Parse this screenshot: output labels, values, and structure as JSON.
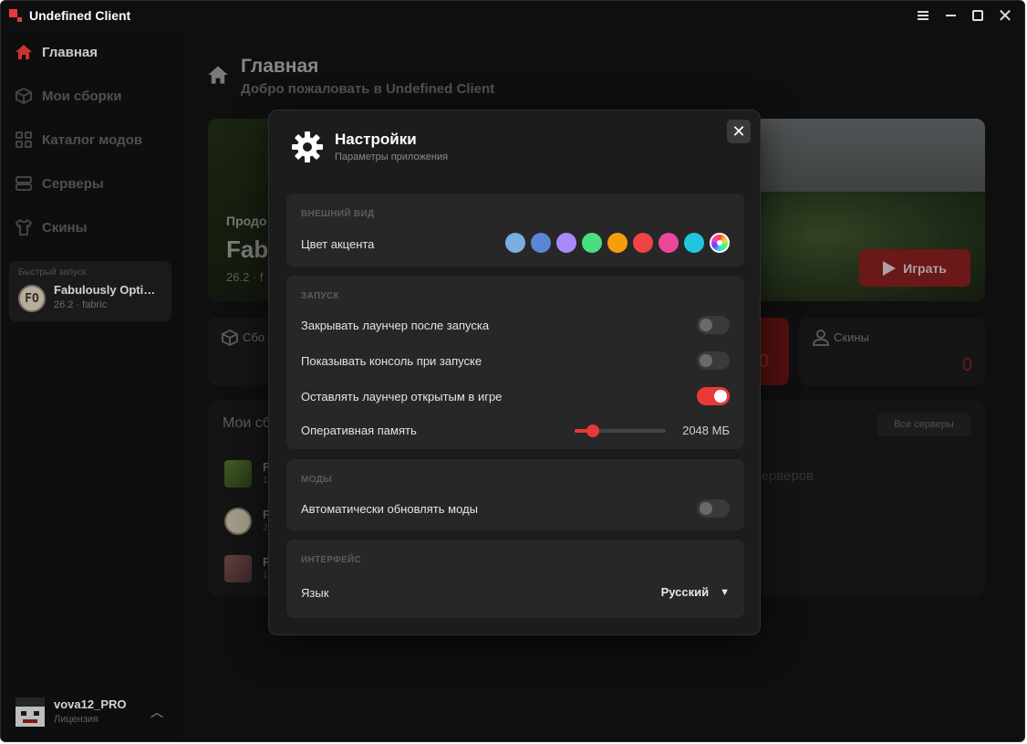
{
  "app": {
    "title": "Undefined Client"
  },
  "sidebar": {
    "items": [
      {
        "label": "Главная",
        "icon": "home-icon",
        "active": true
      },
      {
        "label": "Мои сборки",
        "icon": "cube-icon",
        "active": false
      },
      {
        "label": "Каталог модов",
        "icon": "grid-icon",
        "active": false
      },
      {
        "label": "Серверы",
        "icon": "server-icon",
        "active": false
      },
      {
        "label": "Скины",
        "icon": "shirt-icon",
        "active": false
      }
    ],
    "quick_launch": {
      "title": "Быстрый запуск",
      "avatar_text": "FO",
      "name": "Fabulously Optimized",
      "sub": "26.2 · fabric"
    },
    "user": {
      "name": "vova12_PRO",
      "sub": "Лицензия"
    }
  },
  "main": {
    "title": "Главная",
    "subtitle": "Добро пожаловать в Undefined Client",
    "hero": {
      "kicker": "Продо",
      "title": "Fab",
      "meta": "26.2 · f",
      "play_label": "Играть"
    },
    "stats": [
      {
        "label": "Сбо",
        "icon": "cube-icon"
      },
      {
        "label": "Скины",
        "icon": "user-icon",
        "value": "0"
      }
    ],
    "red_stat_value": "0",
    "panel": {
      "title": "Мои сб",
      "all_servers": "Все серверы",
      "no_servers": "т серверов",
      "mods": [
        {
          "letter": "F",
          "sub": "1"
        },
        {
          "letter": "F",
          "sub": "2"
        },
        {
          "letter": "F",
          "sub": "1"
        }
      ]
    }
  },
  "modal": {
    "title": "Настройки",
    "subtitle": "Параметры приложения",
    "appearance": {
      "title": "ВНЕШНИЙ ВИД",
      "accent_label": "Цвет акцента",
      "swatches": [
        "#7aaee0",
        "#5b86d6",
        "#a78bfa",
        "#4ade80",
        "#f59e0b",
        "#ef4444",
        "#ec4899",
        "#22c5e0"
      ]
    },
    "launch": {
      "title": "ЗАПУСК",
      "close_label": "Закрывать лаунчер после запуска",
      "close_on": false,
      "console_label": "Показывать консоль при запуске",
      "console_on": false,
      "keep_label": "Оставлять лаунчер открытым в игре",
      "keep_on": true,
      "ram_label": "Оперативная память",
      "ram_value": "2048 МБ",
      "ram_fraction": 0.2
    },
    "mods": {
      "title": "МОДЫ",
      "auto_update_label": "Автоматически обновлять моды",
      "auto_update_on": false
    },
    "interface": {
      "title": "ИНТЕРФЕЙС",
      "language_label": "Язык",
      "language_value": "Русский"
    }
  },
  "colors": {
    "accent": "#e83a3a"
  }
}
